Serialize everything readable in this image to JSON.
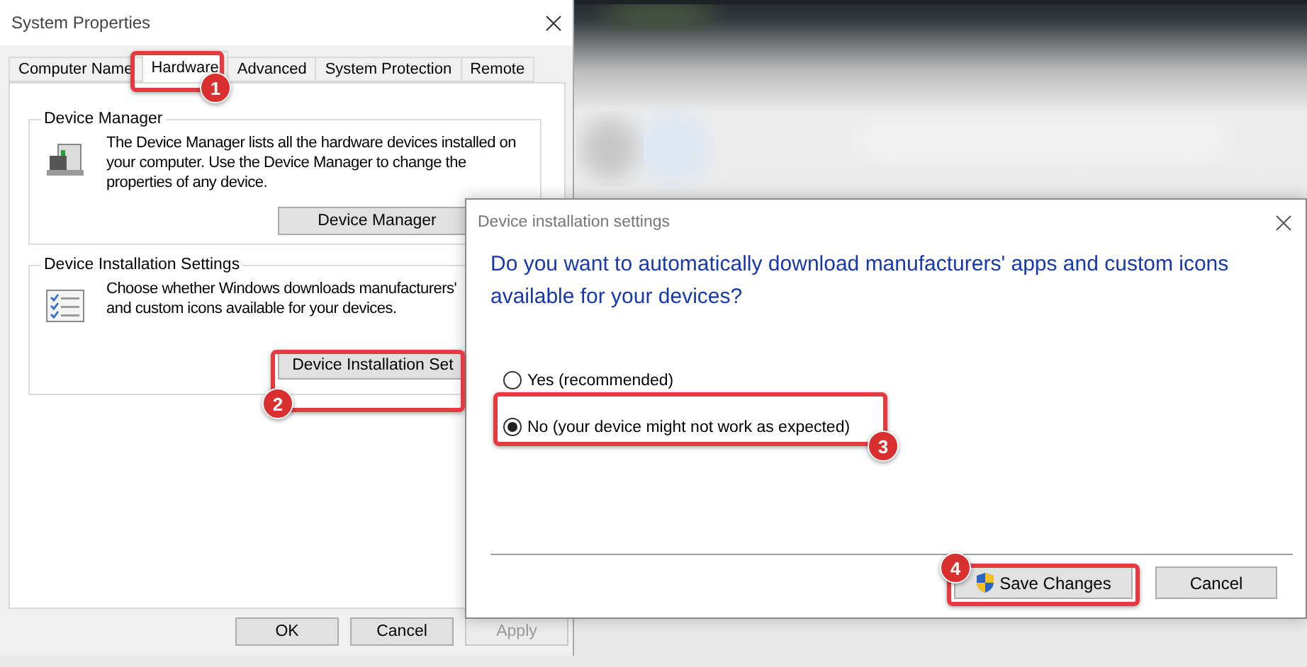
{
  "system_properties": {
    "title": "System Properties",
    "tabs": [
      {
        "label": "Computer Name",
        "selected": false
      },
      {
        "label": "Hardware",
        "selected": true
      },
      {
        "label": "Advanced",
        "selected": false
      },
      {
        "label": "System Protection",
        "selected": false
      },
      {
        "label": "Remote",
        "selected": false
      }
    ],
    "groups": [
      {
        "title": "Device Manager",
        "kind": "device",
        "description": "The Device Manager lists all the hardware devices installed on your computer. Use the Device Manager to change the properties of any device.",
        "button": "Device Manager"
      },
      {
        "title": "Device Installation Settings",
        "kind": "checklist",
        "description": "Choose whether Windows downloads manufacturers' and custom icons available for your devices.",
        "button": "Device Installation Set"
      }
    ],
    "buttons": [
      {
        "label": "OK",
        "disabled": false
      },
      {
        "label": "Cancel",
        "disabled": false
      },
      {
        "label": "Apply",
        "disabled": true
      }
    ]
  },
  "dialog": {
    "title": "Device installation settings",
    "question": "Do you want to automatically download manufacturers' apps and custom icons available for your devices?",
    "options": [
      {
        "label": "Yes (recommended)",
        "selected": false
      },
      {
        "label": "No (your device might not work as expected)",
        "selected": true
      }
    ],
    "buttons": [
      {
        "label": "Save Changes",
        "shield": true
      },
      {
        "label": "Cancel",
        "shield": false
      }
    ]
  },
  "callouts": [
    {
      "number": "1"
    },
    {
      "number": "2"
    },
    {
      "number": "3"
    },
    {
      "number": "4"
    }
  ]
}
